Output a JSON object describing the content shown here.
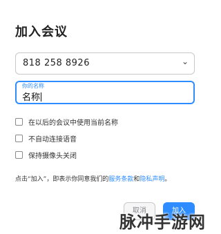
{
  "dialog": {
    "title": "加入会议"
  },
  "meeting_id": {
    "value": "818 258 8926",
    "chevron_icon": "chevron-down-icon"
  },
  "name_field": {
    "label": "你的名称",
    "value": "名称"
  },
  "options": [
    {
      "label": "在以后的会议中使用当前名称",
      "checked": false
    },
    {
      "label": "不自动连接语音",
      "checked": false
    },
    {
      "label": "保持摄像头关闭",
      "checked": false
    }
  ],
  "disclaimer": {
    "prefix": "点击“加入”，即表示你同意我们的",
    "terms_link": "服务条款",
    "conjunction": "和",
    "privacy_link": "隐私声明",
    "suffix": "。"
  },
  "buttons": {
    "cancel": "取消",
    "join": "加入"
  },
  "watermark": "脉冲手游网",
  "colors": {
    "accent": "#2d8cff",
    "border": "#c8c8cc",
    "text": "#222222"
  }
}
